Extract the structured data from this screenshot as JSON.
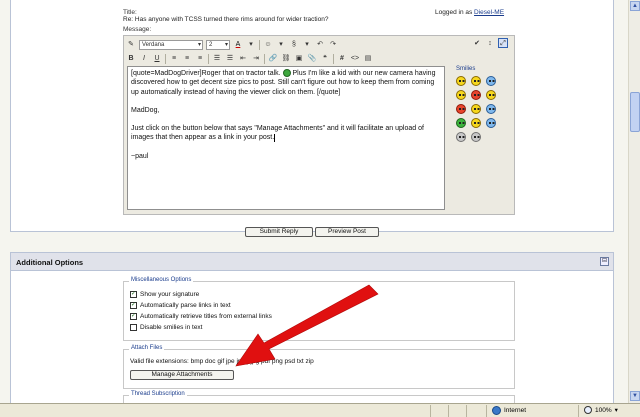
{
  "post": {
    "title_label": "Title:",
    "subject": "Re: Has anyone with TCSS turned there rims around for wider traction?",
    "logged_in_prefix": "Logged in as",
    "username": "Diesel-ME",
    "message_label": "Message:"
  },
  "toolbar": {
    "font_name": "Verdana",
    "font_size": "2",
    "bold": "B",
    "italic": "I",
    "underline": "U",
    "hash": "#"
  },
  "editor": {
    "paragraph1_before": "[quote=MadDogDriver]Roger that on tractor talk.",
    "paragraph1_after": "Plus I'm like a kid with our new camera having discovered how to get decent size pics to post. Still can't figure out how to keep them from coming up automatically instead of having the viewer click on them. [/quote]",
    "paragraph2": "MadDog,",
    "paragraph3": "Just click on the button below that says \"Manage Attachments\" and it will facilitate an upload of images that then appear as a link in your post.",
    "paragraph4": "~paul"
  },
  "smilies": {
    "title": "Smilies"
  },
  "buttons": {
    "submit": "Submit Reply",
    "preview": "Preview Post"
  },
  "additional": {
    "title": "Additional Options",
    "misc_legend": "Miscellaneous Options",
    "options": [
      {
        "label": "Show your signature",
        "checked": true
      },
      {
        "label": "Automatically parse links in text",
        "checked": true
      },
      {
        "label": "Automatically retrieve titles from external links",
        "checked": true
      },
      {
        "label": "Disable smilies in text",
        "checked": false
      }
    ],
    "attach_legend": "Attach Files",
    "extensions_label": "Valid file extensions: bmp doc gif jpe jpeg jpg pdf png psd txt zip",
    "manage_button": "Manage Attachments",
    "thread_legend": "Thread Subscription"
  },
  "status": {
    "zone": "Internet",
    "zoom": "100%"
  },
  "colors": {
    "arrow": "#e01010",
    "link": "#1a3c8c",
    "panel_border": "#b9c3d6"
  }
}
